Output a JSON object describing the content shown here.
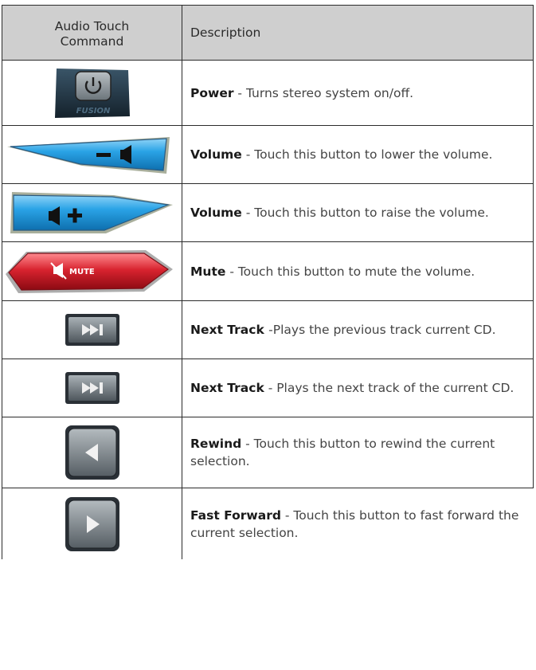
{
  "table": {
    "header": {
      "command": "Audio Touch Command",
      "description": "Description"
    },
    "rows": [
      {
        "icon": "power-button-icon",
        "term": "Power",
        "text": " - Turns stereo system on/off.",
        "logo": "FUSION"
      },
      {
        "icon": "volume-down-button-icon",
        "term": "Volume",
        "text": " - Touch this button to lower the volume."
      },
      {
        "icon": "volume-up-button-icon",
        "term": "Volume",
        "text": " - Touch this button to raise the volume."
      },
      {
        "icon": "mute-button-icon",
        "term": "Mute",
        "text": " - Touch this button to mute the volume.",
        "label": "MUTE"
      },
      {
        "icon": "next-track-button-icon",
        "term": "Next Track ",
        "text": " -Plays the previous track current CD."
      },
      {
        "icon": "next-track-button-icon",
        "term": "Next Track",
        "text": " - Plays the next track of the current CD."
      },
      {
        "icon": "rewind-button-icon",
        "term": "Rewind",
        "text": " - Touch this button to rewind the current selection."
      },
      {
        "icon": "fast-forward-button-icon",
        "term": "Fast Forward",
        "text": " - Touch this button to fast forward the current selection."
      }
    ]
  },
  "colors": {
    "header_bg": "#cfcfcf",
    "volume_blue": "#2aa3e6",
    "mute_red": "#d8232f",
    "button_gray": "#7a8288"
  }
}
